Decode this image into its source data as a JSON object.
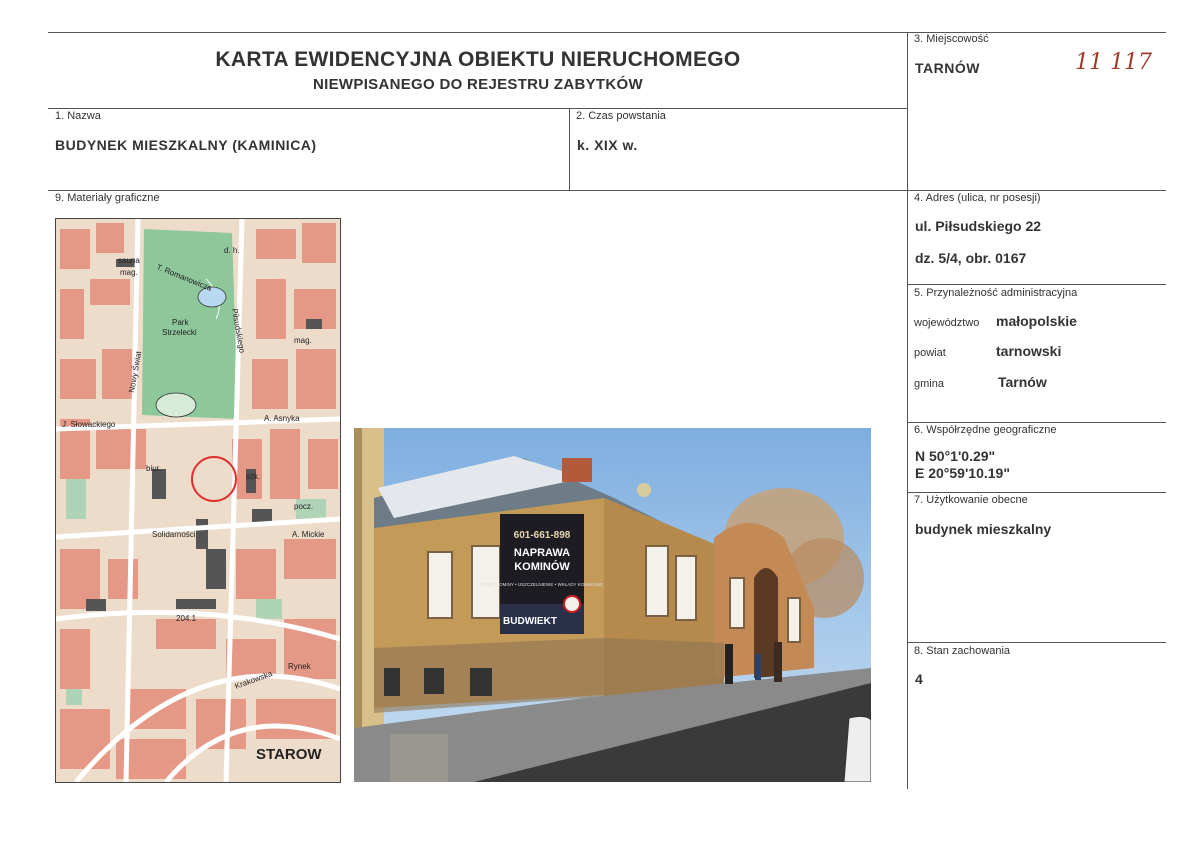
{
  "title": {
    "line1": "KARTA EWIDENCYJNA OBIEKTU NIERUCHOMEGO",
    "line2": "NIEWPISANEGO DO REJESTRU ZABYTKÓW"
  },
  "signum": "11 117",
  "fields": {
    "miejscowosc": {
      "label": "3. Miejscowość",
      "value": "TARNÓW"
    },
    "nazwa": {
      "label": "1. Nazwa",
      "value": "BUDYNEK MIESZKALNY (KAMINICA)"
    },
    "czas": {
      "label": "2. Czas powstania",
      "value": "k. XIX w."
    },
    "materialy": {
      "label": "9. Materiały graficzne"
    },
    "adres": {
      "label": "4. Adres (ulica, nr posesji)",
      "line1": "ul. Piłsudskiego 22",
      "line2": "dz. 5/4, obr. 0167"
    },
    "administracja": {
      "label": "5. Przynależność administracyjna",
      "wojewodztwo_label": "województwo",
      "wojewodztwo": "małopolskie",
      "powiat_label": "powiat",
      "powiat": "tarnowski",
      "gmina_label": "gmina",
      "gmina": "Tarnów"
    },
    "wspolrzedne": {
      "label": "6. Współrzędne geograficzne",
      "n": "N 50°1'0.29\"",
      "e": "E 20°59'10.19\""
    },
    "uzytkowanie": {
      "label": "7. Użytkowanie obecne",
      "value": "budynek mieszkalny"
    },
    "stan": {
      "label": "8. Stan zachowania",
      "value": "4"
    }
  },
  "map": {
    "labels": {
      "sauna": "sauna",
      "mag1": "mag.",
      "romanowicza": "T. Romanowicza",
      "park": "Park",
      "strzelecki": "Strzelecki",
      "nowy_swiat": "Nowy Świat",
      "pilsudskiego": "Piłsudskiego",
      "slowackiego": "J. Słowackiego",
      "asnyka": "A. Asnyka",
      "solidarnosci": "Solidarności",
      "mickiewicza": "A. Mickie",
      "krakowska": "Krakowska",
      "rynek": "Rynek",
      "starowka": "STAROW",
      "biur": "biur.",
      "szk": "szk.",
      "mag2": "mag.",
      "num": "204.1",
      "pocz": "pocz.",
      "dh": "d. h."
    }
  },
  "photo": {
    "sign_phone": "601-661-898",
    "sign_title1": "NAPRAWA",
    "sign_title2": "KOMINÓW",
    "sign_brand": "BUDWIEKT",
    "sign_small": "NOWE KOMINY • USZCZELNIENIE • WKŁADY KOMINOWE"
  },
  "colors": {
    "signum": "#a03a2a",
    "map_marker": "#e03030"
  }
}
